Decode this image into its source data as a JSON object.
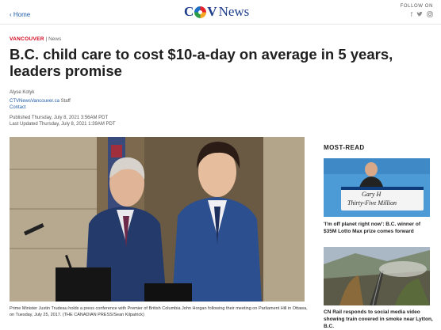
{
  "nav": {
    "home_label": "Home",
    "back_glyph": "‹"
  },
  "brand": {
    "logo_left": "C",
    "logo_right": "V",
    "logo_news": "News"
  },
  "follow": {
    "label": "FOLLOW ON",
    "icons": [
      "facebook-icon",
      "twitter-icon",
      "instagram-icon"
    ]
  },
  "article": {
    "section": "VANCOUVER",
    "subsection": "News",
    "headline": "B.C. child care to cost $10-a-day on average in 5 years, leaders promise",
    "author": "Alyse Kotyk",
    "email": "CTVNewsVancouver.ca",
    "role": " Staff",
    "contact": "Contact",
    "published": "Published Thursday, July 8, 2021 3:56AM PDT",
    "updated": "Last Updated Thursday, July 8, 2021 1:39AM PDT",
    "caption": "Prime Minister Justin Trudeau holds a press conference with Premier of British Columbia John Horgan following their meeting on Parliament Hill in Ottawa, on Tuesday, July 25, 2017. (THE CANADIAN PRESS/Sean Kilpatrick)"
  },
  "most_read": {
    "title": "MOST-READ",
    "items": [
      {
        "headline": "'I'm off planet right now': B.C. winner of $35M Lotto Max prize comes forward",
        "cheque_line1": "Gary H",
        "cheque_line2": "Thirty-Five Million"
      },
      {
        "headline": "CN Rail responds to social media video showing train covered in smoke near Lytton, B.C."
      }
    ]
  },
  "colors": {
    "accent_red": "#d0021b",
    "link_blue": "#1e5aa8",
    "brand_navy": "#1e3e8c"
  }
}
